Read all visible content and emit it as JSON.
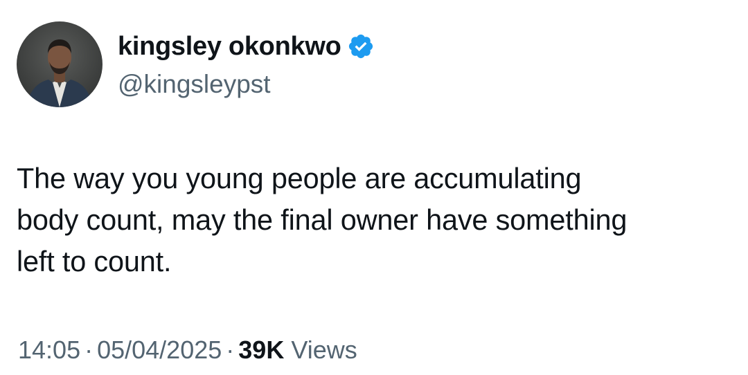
{
  "author": {
    "display_name": "kingsley okonkwo",
    "handle": "@kingsleypst",
    "verified": true,
    "verified_color": "#1d9bf0"
  },
  "tweet": {
    "text_lines": [
      "The way you young people are accumulating",
      "body count, may the final owner have something",
      "left to count."
    ]
  },
  "meta": {
    "time": "14:05",
    "separator": "·",
    "date": "05/04/2025",
    "views_count": "39K",
    "views_label": "Views"
  },
  "icons": {
    "avatar": "avatar-photo",
    "verified": "verified-badge-icon"
  }
}
